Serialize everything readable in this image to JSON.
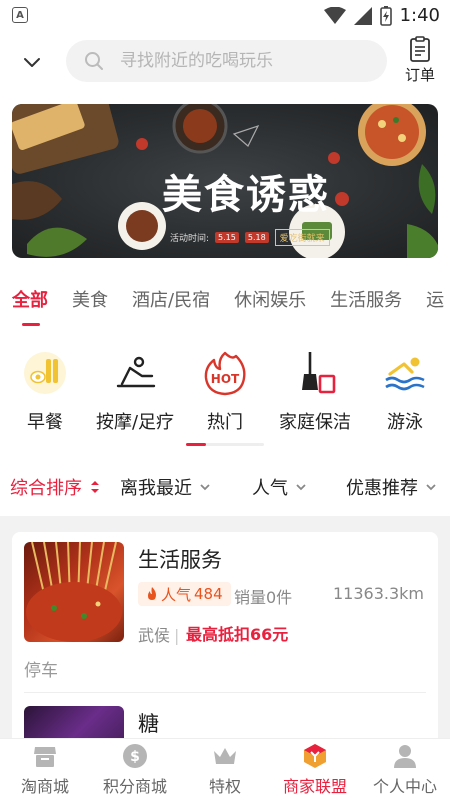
{
  "status_bar": {
    "time": "1:40"
  },
  "header": {
    "search_placeholder": "寻找附近的吃喝玩乐",
    "orders_label": "订单"
  },
  "banner": {
    "title": "美食诱惑",
    "sub_label": "活动时间:",
    "date_start": "5.15",
    "date_end": "5.18",
    "tag": "爱吃街就来"
  },
  "tabs": [
    "全部",
    "美食",
    "酒店/民宿",
    "休闲娱乐",
    "生活服务",
    "运"
  ],
  "services": [
    {
      "label": "早餐",
      "icon": "breakfast-icon"
    },
    {
      "label": "按摩/足疗",
      "icon": "massage-icon"
    },
    {
      "label": "热门",
      "icon": "hot-icon",
      "badge": "HOT"
    },
    {
      "label": "家庭保洁",
      "icon": "cleaning-icon"
    },
    {
      "label": "游泳",
      "icon": "swimming-icon"
    }
  ],
  "sort": [
    "综合排序",
    "离我最近",
    "人气",
    "优惠推荐"
  ],
  "shops": [
    {
      "name": "生活服务",
      "popularity_label": "人气",
      "popularity": "484",
      "sales": "销量0件",
      "distance": "11363.3km",
      "district": "武侯",
      "discount": "最高抵扣66元",
      "tag": "停车"
    },
    {
      "name": "糖"
    }
  ],
  "bottom_nav": [
    {
      "label": "淘商城",
      "icon": "store-icon"
    },
    {
      "label": "积分商城",
      "icon": "coin-icon"
    },
    {
      "label": "特权",
      "icon": "crown-icon"
    },
    {
      "label": "商家联盟",
      "icon": "merchant-icon"
    },
    {
      "label": "个人中心",
      "icon": "user-icon"
    }
  ],
  "colors": {
    "accent": "#e8213e",
    "accent_orange": "#e8541e"
  }
}
